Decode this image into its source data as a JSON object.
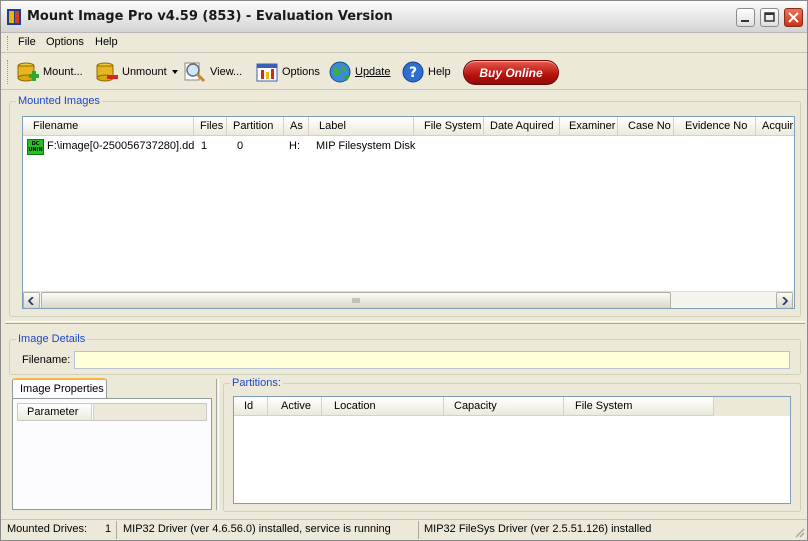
{
  "window": {
    "title": "Mount Image Pro v4.59 (853) - Evaluation Version"
  },
  "menu": [
    "File",
    "Options",
    "Help"
  ],
  "toolbar": {
    "mount": "Mount...",
    "unmount": "Unmount",
    "view": "View...",
    "options": "Options",
    "update": "Update",
    "help": "Help",
    "buy": "Buy Online"
  },
  "mounted_images": {
    "legend": "Mounted Images",
    "columns": [
      "Filename",
      "Files",
      "Partition",
      "As",
      "Label",
      "File System",
      "Date Aquired",
      "Examiner",
      "Case No",
      "Evidence No",
      "Acquir"
    ],
    "rows": [
      {
        "icon_text": "DC UNIN",
        "filename": "F:\\image[0-250056737280].dd",
        "files": "1",
        "partition": "0",
        "as": "H:",
        "label": "MIP Filesystem Disk"
      }
    ]
  },
  "image_details": {
    "legend": "Image Details",
    "filename_label": "Filename:",
    "filename_value": ""
  },
  "image_properties": {
    "tab_label": "Image Properties",
    "columns": [
      "Parameter"
    ]
  },
  "partitions": {
    "legend": "Partitions:",
    "columns": [
      "Id",
      "Active",
      "Location",
      "Capacity",
      "File System"
    ]
  },
  "status": {
    "mounted_label": "Mounted Drives:",
    "mounted_count": "1",
    "driver": "MIP32 Driver (ver 4.6.56.0) installed, service is running",
    "fs_driver": "MIP32 FileSys Driver (ver 2.5.51.126) installed"
  }
}
